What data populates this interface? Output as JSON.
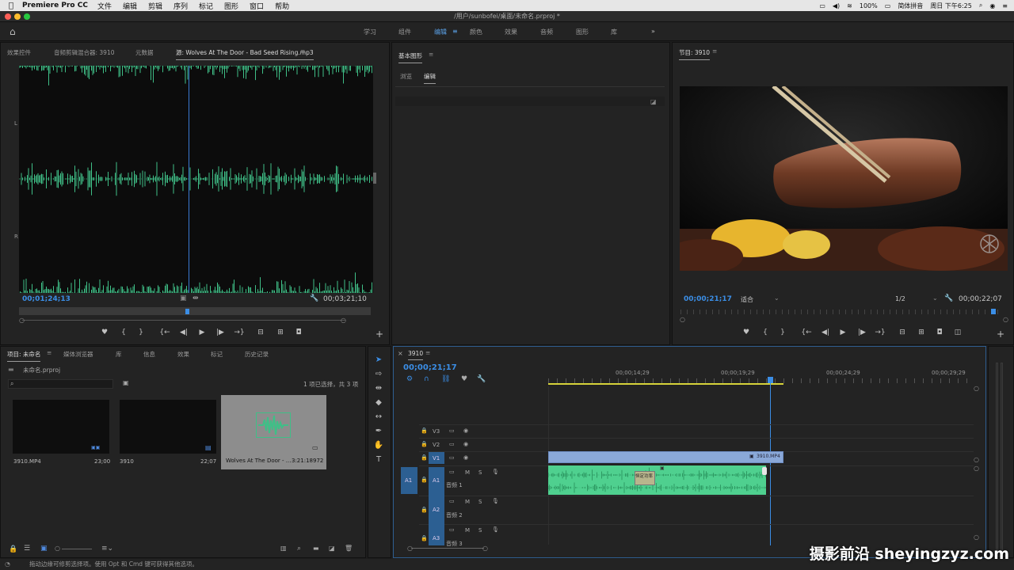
{
  "menubar": {
    "app_name": "Premiere Pro CC",
    "items": [
      "文件",
      "编辑",
      "剪辑",
      "序列",
      "标记",
      "图形",
      "窗口",
      "帮助"
    ],
    "battery": "100%",
    "input_method": "简体拼音",
    "clock": "周日 下午6:25"
  },
  "window": {
    "title": "/用户/sunbofei/桌面/未命名.prproj *"
  },
  "workspaces": {
    "items": [
      "学习",
      "组件",
      "编辑",
      "颜色",
      "效果",
      "音频",
      "图形",
      "库"
    ],
    "active": "编辑",
    "more": "»"
  },
  "source_panel": {
    "tabs": [
      "效果控件",
      "音频剪辑混合器: 3910",
      "元数据",
      "源: Wolves At The Door - Bad Seed Rising.mp3"
    ],
    "channel_left": "L",
    "channel_right": "R",
    "timecode_current": "00;01;24;13",
    "timecode_duration": "00;03;21;10"
  },
  "essential_graphics": {
    "title": "基本图形",
    "tabs": [
      "浏览",
      "编辑"
    ]
  },
  "program_panel": {
    "title": "节目: 3910",
    "timecode_current": "00;00;21;17",
    "fit": "适合",
    "resolution": "1/2",
    "timecode_duration": "00;00;22;07"
  },
  "project_panel": {
    "tabs": [
      "项目: 未命名",
      "媒体浏览器",
      "库",
      "信息",
      "效果",
      "标记",
      "历史记录"
    ],
    "file": "未命名.prproj",
    "selection_info": "1 项已选择，共 3 项",
    "items": [
      {
        "name": "3910.MP4",
        "duration": "23;00"
      },
      {
        "name": "3910",
        "duration": "22;07"
      },
      {
        "name": "Wolves At The Door - ...",
        "duration": "3:21:18972"
      }
    ]
  },
  "timeline": {
    "title": "3910",
    "timecode": "00;00;21;17",
    "ruler": [
      "00;00;14;29",
      "00;00;19;29",
      "00;00;24;29",
      "00;00;29;29"
    ],
    "tracks_video": [
      "V3",
      "V2",
      "V1"
    ],
    "tracks_audio": [
      {
        "id": "A1",
        "name": "音频 1"
      },
      {
        "id": "A2",
        "name": "音频 2"
      },
      {
        "id": "A3",
        "name": "音频 3"
      }
    ],
    "source_patch": "A1",
    "clip_video": "3910.MP4",
    "clip_audio_tag": "恒定功率",
    "btn_m": "M",
    "btn_s": "S"
  },
  "status": {
    "text": "拖动边缘可修剪选择项。使用 Opt 和 Cmd 键可获得其他选项。"
  },
  "watermark": "摄影前沿 sheyingzyz.com",
  "colors": {
    "accent": "#3b8ee6",
    "waveform": "#3fbf87",
    "audio_clip": "#4fd08f",
    "video_clip": "#8aa8d8"
  }
}
